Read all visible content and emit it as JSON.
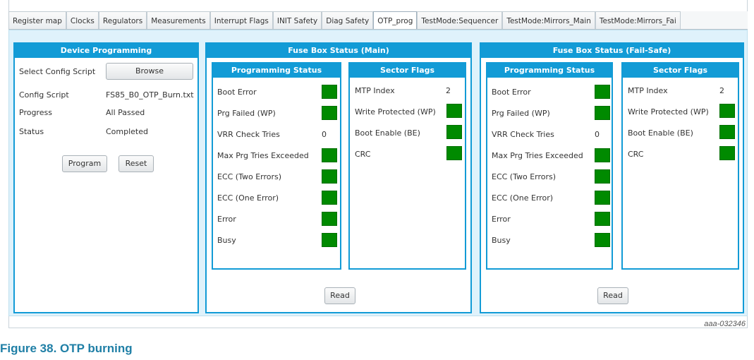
{
  "tabs": [
    "Register map",
    "Clocks",
    "Regulators",
    "Measurements",
    "Interrupt Flags",
    "INIT Safety",
    "Diag Safety",
    "OTP_prog",
    "TestMode:Sequencer",
    "TestMode:Mirrors_Main",
    "TestMode:Mirrors_Fai"
  ],
  "active_tab": "OTP_prog",
  "device_programming": {
    "title": "Device Programming",
    "select_label": "Select Config Script",
    "browse": "Browse",
    "config_label": "Config Script",
    "config_value": "FS85_B0_OTP_Burn.txt",
    "progress_label": "Progress",
    "progress_value": "All Passed",
    "status_label": "Status",
    "status_value": "Completed",
    "program": "Program",
    "reset": "Reset"
  },
  "fuse_main": {
    "title": "Fuse Box Status (Main)",
    "prog_title": "Programming Status",
    "sector_title": "Sector Flags",
    "prog_rows": [
      "Boot Error",
      "Prg Failed (WP)",
      "VRR Check Tries",
      "Max Prg Tries Exceeded",
      "ECC (Two Errors)",
      "ECC (One Error)",
      "Error",
      "Busy"
    ],
    "vrr_value": "0",
    "sector_rows": [
      "MTP Index",
      "Write Protected (WP)",
      "Boot Enable (BE)",
      "CRC"
    ],
    "mtp_value": "2",
    "read": "Read"
  },
  "fuse_failsafe": {
    "title": "Fuse Box Status (Fail-Safe)",
    "prog_title": "Programming Status",
    "sector_title": "Sector Flags",
    "prog_rows": [
      "Boot Error",
      "Prg Failed (WP)",
      "VRR Check Tries",
      "Max Prg Tries Exceeded",
      "ECC (Two Errors)",
      "ECC (One Error)",
      "Error",
      "Busy"
    ],
    "vrr_value": "0",
    "sector_rows": [
      "MTP Index",
      "Write Protected (WP)",
      "Boot Enable (BE)",
      "CRC"
    ],
    "mtp_value": "2",
    "read": "Read"
  },
  "indicator_color": "#008a00",
  "accent_color": "#129bd6",
  "figure_id": "aaa-032346",
  "caption": "Figure 38.  OTP burning"
}
